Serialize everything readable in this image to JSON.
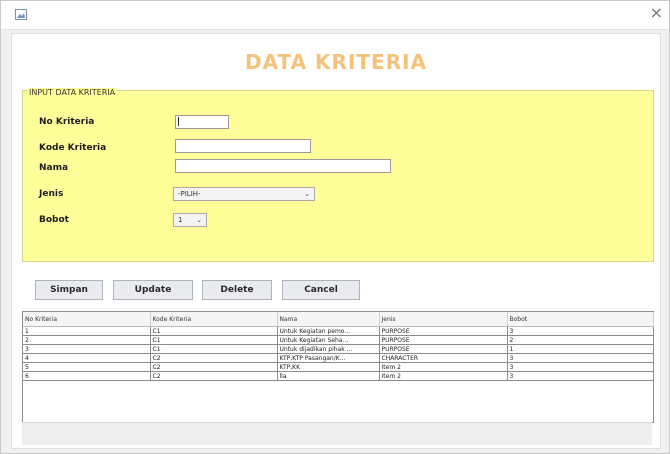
{
  "window": {
    "close_label": "×"
  },
  "heading": "DATA KRITERIA",
  "form": {
    "panel_title": "INPUT DATA KRITERIA",
    "fields": {
      "no_kriteria_label": "No Kriteria",
      "no_kriteria_value": "",
      "kode_kriteria_label": "Kode Kriteria",
      "kode_kriteria_value": "",
      "nama_label": "Nama",
      "nama_value": "",
      "jenis_label": "Jenis",
      "jenis_selected": "-PILIH-",
      "bobot_label": "Bobot",
      "bobot_selected": "1"
    },
    "dropdown_icon": "chevron-down-icon"
  },
  "buttons": {
    "simpan": "Simpan",
    "update": "Update",
    "delete": "Delete",
    "cancel": "Cancel"
  },
  "table": {
    "columns": [
      "No Kriteria",
      "Kode Kriteria",
      "Nama",
      "Jenis",
      "Bobot"
    ],
    "rows": [
      [
        "1",
        "C1",
        "Untuk Kegiatan pemo...",
        "PURPOSE",
        "3"
      ],
      [
        "2",
        "C1",
        "Untuk Kegiatan Seha...",
        "PURPOSE",
        "2"
      ],
      [
        "3",
        "C1",
        "Untuk dijadikan pihak ...",
        "PURPOSE",
        "1"
      ],
      [
        "4",
        "C2",
        "KTP,KTP Pasangan/K...",
        "CHARACTER",
        "3"
      ],
      [
        "5",
        "C2",
        "KTP,KK",
        "Item 2",
        "3"
      ],
      [
        "6",
        "C2",
        "lla",
        "Item 2",
        "3"
      ]
    ]
  },
  "colors": {
    "heading": "#f6c27a",
    "panel_bg": "#ffff99",
    "window_bg": "#f0f0f0"
  }
}
